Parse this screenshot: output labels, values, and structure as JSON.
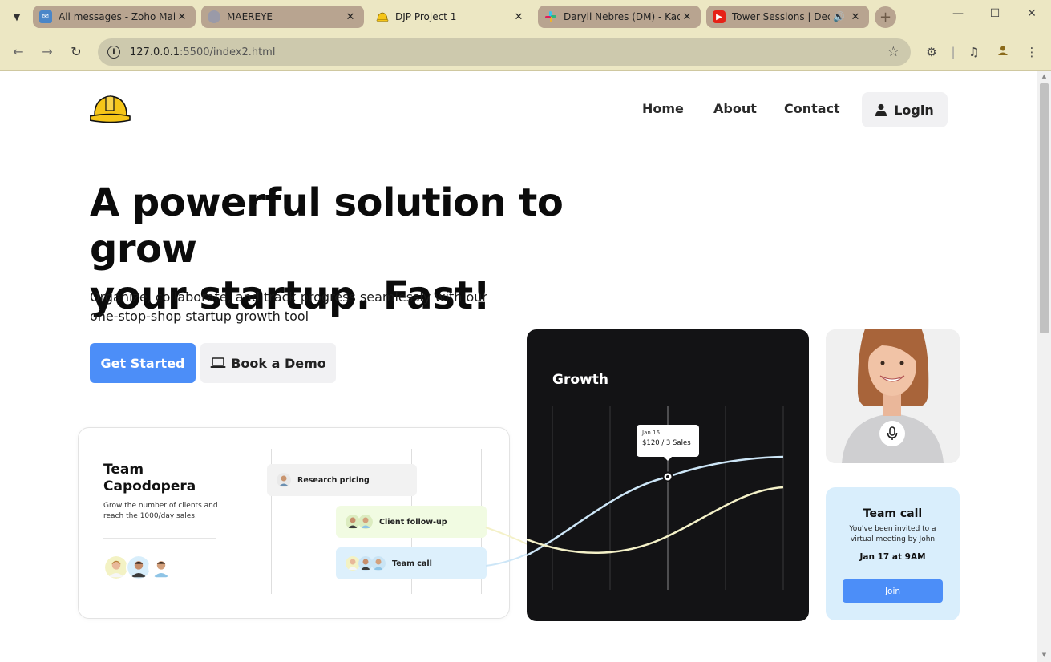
{
  "browser": {
    "tabs": [
      {
        "title": "All messages - Zoho Mail (",
        "icon": "mail-icon",
        "active": false
      },
      {
        "title": "MAEREYE",
        "icon": "globe-icon",
        "active": false
      },
      {
        "title": "DJP Project 1",
        "icon": "hardhat-icon",
        "active": true
      },
      {
        "title": "Daryll Nebres (DM) - Kade",
        "icon": "slack-icon",
        "active": false
      },
      {
        "title": "Tower Sessions | Dece",
        "icon": "youtube-icon",
        "active": false
      }
    ],
    "url_host": "127.0.0.1",
    "url_rest": ":5500/index2.html"
  },
  "nav": {
    "links": [
      "Home",
      "About",
      "Contact"
    ],
    "login_label": "Login"
  },
  "hero": {
    "title_line1": "A powerful solution to grow",
    "title_line2": "your startup. Fast!",
    "subtitle_line1": "Organize, collaborate, and track progress seamlessly with our",
    "subtitle_line2": "one-stop-shop startup growth tool",
    "primary_cta": "Get Started",
    "secondary_cta": "Book a Demo"
  },
  "team_card": {
    "name_line1": "Team",
    "name_line2": "Capodopera",
    "description": "Grow the number of clients and reach the 1000/day sales.",
    "tasks": [
      {
        "label": "Research pricing",
        "color": "#f2f2f2"
      },
      {
        "label": "Client follow-up",
        "color": "#f1fbe2"
      },
      {
        "label": "Team call",
        "color": "#ddf0fc"
      }
    ]
  },
  "growth_card": {
    "title": "Growth",
    "tooltip_date": "Jan 16",
    "tooltip_value": "$120 / 3 Sales",
    "line_colors": [
      "#cde6f7",
      "#f4f1c8"
    ]
  },
  "call_card": {
    "title": "Team call",
    "description": "You've been invited to a virtual meeting by John",
    "date": "Jan 17 at 9AM",
    "join_label": "Join"
  },
  "colors": {
    "accent": "#4c8ef8",
    "chrome": "#ece7c3",
    "tab_inactive": "#b8a490"
  }
}
